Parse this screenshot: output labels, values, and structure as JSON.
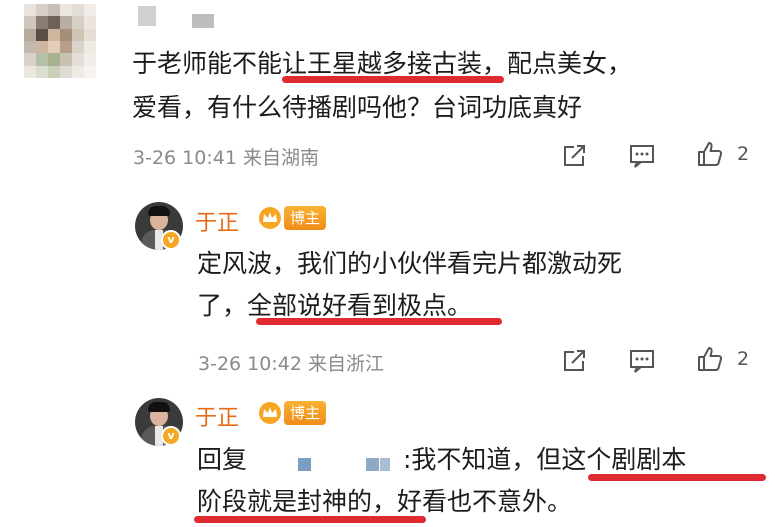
{
  "comment1": {
    "text_line1": "于老师能不能让王星越多接古装，配点美女，",
    "text_line2": "爱看，有什么待播剧吗他？台词功底真好",
    "time": "3-26 10:41 来自湖南",
    "like_count": "2"
  },
  "reply1": {
    "author": "于正",
    "badge": "博主",
    "text_line1": "定风波，我们的小伙伴看完片都激动死",
    "text_line2": "了，全部说好看到极点。",
    "time": "3-26 10:42 来自浙江",
    "like_count": "2"
  },
  "reply2": {
    "author": "于正",
    "badge": "博主",
    "reply_prefix": "回复",
    "text_line1_after": ":我不知道，但这个剧剧本",
    "text_line2": "阶段就是封神的，好看也不意外。"
  },
  "colors": {
    "underline": "#e02a31",
    "author": "#e86b17",
    "meta": "#8a8a8a"
  },
  "icons": [
    "share-icon",
    "comment-icon",
    "like-icon",
    "crown-icon"
  ]
}
